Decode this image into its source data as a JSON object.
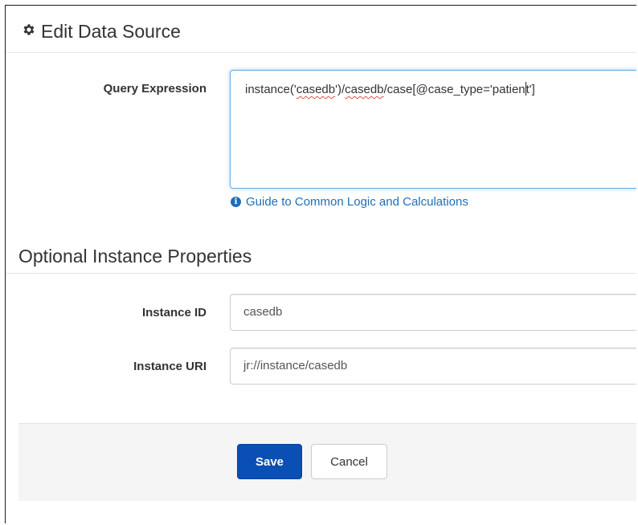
{
  "header": {
    "title": "Edit Data Source",
    "icon": "gear-icon"
  },
  "query": {
    "label": "Query Expression",
    "value_parts": [
      "instance('",
      "casedb",
      "')/",
      "casedb",
      "/case[@case_type='patien",
      "t']"
    ]
  },
  "help_link": {
    "icon": "info-icon",
    "text": "Guide to Common Logic and Calculations"
  },
  "optional": {
    "title": "Optional Instance Properties"
  },
  "instance_id": {
    "label": "Instance ID",
    "value": "casedb"
  },
  "instance_uri": {
    "label": "Instance URI",
    "value": "jr://instance/casedb"
  },
  "footer": {
    "save_label": "Save",
    "cancel_label": "Cancel"
  },
  "colors": {
    "primary": "#0a4fb3",
    "link": "#1f6fb5",
    "focus_border": "#66afe9",
    "footer_bg": "#f5f5f5"
  }
}
